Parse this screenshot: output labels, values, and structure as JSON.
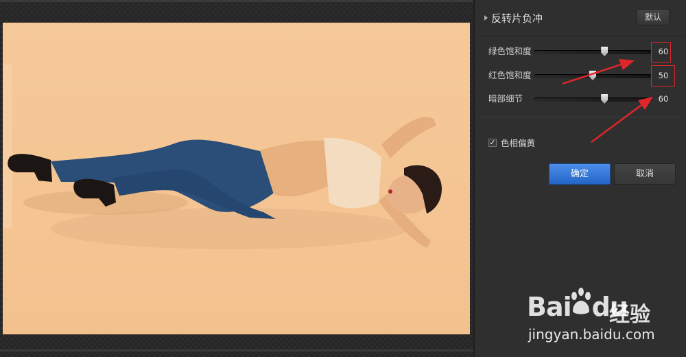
{
  "panel": {
    "title": "反转片负冲",
    "default_label": "默认",
    "sliders": [
      {
        "label": "绿色饱和度",
        "value": "60",
        "level": 0.6
      },
      {
        "label": "红色饱和度",
        "value": "50",
        "level": 0.5
      },
      {
        "label": "暗部细节",
        "value": "60",
        "level": 0.6
      }
    ],
    "checkbox": {
      "label": "色相偏黄",
      "checked": true
    },
    "ok_label": "确定",
    "cancel_label": "取消"
  },
  "watermark": {
    "brand_left": "Bai",
    "brand_right": "du",
    "brand_cn": "经验",
    "url": "jingyan.baidu.com"
  },
  "colors": {
    "accent": "#2f73d8",
    "annotation": "#e0262a",
    "photo_tone": "#f4c593",
    "panel_bg": "#2f2f2f"
  }
}
